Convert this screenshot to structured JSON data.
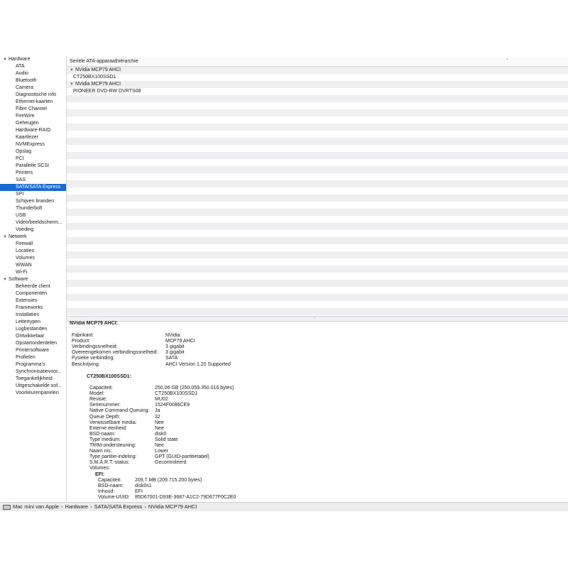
{
  "sidebar": {
    "groups": [
      {
        "label": "Hardware",
        "items": [
          "ATA",
          "Audio",
          "Bluetooth",
          "Camera",
          "Diagnostische info",
          "Ethernet-kaarten",
          "Fibre Channel",
          "FireWire",
          "Geheugen",
          "Hardware-RAID",
          "Kaartlezer",
          "NVMExpress",
          "Opslag",
          "PCI",
          "Parallelle SCSI",
          "Printers",
          "SAS",
          "SATA/SATA Express",
          "SPI",
          "Schijven branden",
          "Thunderbolt",
          "USB",
          "Video/beeldscherm...",
          "Voeding"
        ]
      },
      {
        "label": "Netwerk",
        "items": [
          "Firewall",
          "Locaties",
          "Volumes",
          "WWAN",
          "Wi-Fi"
        ]
      },
      {
        "label": "Software",
        "items": [
          "Beheerde client",
          "Componenten",
          "Extensies",
          "Frameworks",
          "Installaties",
          "Lettertypen",
          "Logbestanden",
          "Ontwikkelaar",
          "Opstartonderdelen",
          "Printersoftware",
          "Profielen",
          "Programma's",
          "Synchronisatievoor...",
          "Toegankelijkheid",
          "Uitgeschakelde sof...",
          "Voorkeurenpanelen"
        ]
      }
    ],
    "selected": "SATA/SATA Express"
  },
  "table": {
    "header": "Seriële ATA-apparaathiërarchie",
    "rows": [
      {
        "text": "NVidia MCP79 AHCI",
        "level": 0,
        "expanded": true
      },
      {
        "text": "CT250BX100SSD1",
        "level": 1
      },
      {
        "text": "NVidia MCP79 AHCI",
        "level": 0,
        "expanded": true
      },
      {
        "text": "PIONEER DVD-RW  DVRTS08",
        "level": 1
      }
    ]
  },
  "detail": {
    "title": "NVidia MCP79 AHCI:",
    "controller": [
      [
        "Fabrikant:",
        "NVidia"
      ],
      [
        "Product:",
        "MCP79 AHCI"
      ],
      [
        "Verbindingssnelheid:",
        "3 gigabit"
      ],
      [
        "Overeengekomen verbindingssnelheid:",
        "3 gigabit"
      ],
      [
        "Fysieke verbinding:",
        "SATA"
      ],
      [
        "Beschrijving:",
        "AHCI Version 1.20 Supported"
      ]
    ],
    "device_title": "CT250BX100SSD1:",
    "device": [
      [
        "Capaciteit:",
        "250,06 GB (250.059.350.016 bytes)"
      ],
      [
        "Model:",
        "CT250BX100SSD1"
      ],
      [
        "Revisie:",
        "MU02"
      ],
      [
        "Serienummer:",
        "1524F0086CE9"
      ],
      [
        "Native Command Queuing:",
        "Ja"
      ],
      [
        "Queue Depth:",
        "32"
      ],
      [
        "Verwisselbare media:",
        "Nee"
      ],
      [
        "Externe eenheid:",
        "Nee"
      ],
      [
        "BSD-naam:",
        "disk0"
      ],
      [
        "Type medium:",
        "Solid state"
      ],
      [
        "TRIM-ondersteuning:",
        "Nee"
      ],
      [
        "Naam nis:",
        "Lower"
      ],
      [
        "Type partitie-indeling:",
        "GPT (GUID-partitietabel)"
      ],
      [
        "S.M.A.R.T.-status:",
        "Gecontroleerd"
      ],
      [
        "Volumes:",
        ""
      ]
    ],
    "volume_title": "EFI:",
    "volume": [
      [
        "Capaciteit:",
        "209,7 MB (209.715.200 bytes)"
      ],
      [
        "BSD-naam:",
        "disk0s1"
      ],
      [
        "Inhoud:",
        "EFI"
      ],
      [
        "Volume-UUID:",
        "85D67001-D93E-3687-A1C2-79D677F0C2E0"
      ]
    ]
  },
  "pathbar": {
    "crumbs": [
      "Mac mini van Apple",
      "Hardware",
      "SATA/SATA Express",
      "NVidia MCP79 AHCI"
    ],
    "separator": "›"
  },
  "colors": {
    "selection": "#1a68d4",
    "stripe": "#efeff1"
  },
  "icons": {
    "computer": "mac-mini-icon",
    "disclosure": "disclosure-triangle-icon",
    "sort": "sort-chevron-icon"
  }
}
